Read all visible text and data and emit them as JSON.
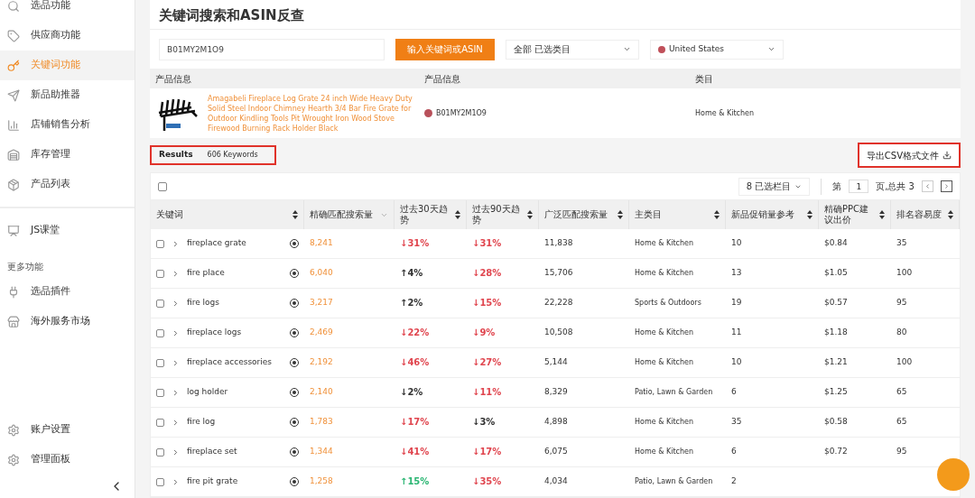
{
  "sidebar": {
    "items": [
      {
        "label": "选品功能",
        "selected": false
      },
      {
        "label": "供应商功能",
        "selected": false
      },
      {
        "label": "关键词功能",
        "selected": true
      },
      {
        "label": "新品助推器",
        "selected": false
      },
      {
        "label": "店铺销售分析",
        "selected": false
      },
      {
        "label": "库存管理",
        "selected": false
      },
      {
        "label": "产品列表",
        "selected": false
      },
      {
        "label": "JS课堂",
        "selected": false
      }
    ],
    "more_heading": "更多功能",
    "more_items": [
      {
        "label": "选品插件",
        "selected": false
      },
      {
        "label": "海外服务市场",
        "selected": false
      }
    ],
    "bottom_items": [
      {
        "label": "账户设置",
        "selected": false
      },
      {
        "label": "管理面板",
        "selected": false
      }
    ]
  },
  "page_title": "关键词搜索和ASIN反查",
  "search": {
    "value": "B01MY2M1O9",
    "button": "输入关键词或ASIN",
    "category": "全部 已选类目",
    "country": "United States"
  },
  "product_table": {
    "columns": [
      "产品信息",
      "产品信息",
      "类目"
    ],
    "row": {
      "title": "Amagabeli Fireplace Log Grate 24 inch Wide Heavy Duty Solid Steel Indoor Chimney Hearth 3/4 Bar Fire Grate for Outdoor Kindling Tools Pit Wrought Iron Wood Stove Firewood Burning Rack Holder Black",
      "asin": "B01MY2M1O9",
      "category": "Home & Kitchen"
    }
  },
  "results": {
    "label": "Results",
    "count": "606 Keywords",
    "highlighted": true
  },
  "export_button": {
    "label": "导出CSV格式文件",
    "highlighted": true
  },
  "toolbar": {
    "select_all_checked": false,
    "columns_select": "8 已选栏目",
    "page_prefix": "第",
    "page": "1",
    "page_suffix": "页,总共 3"
  },
  "keyword_table": {
    "columns": [
      "关键词",
      "精确匹配搜索量",
      "过去30天趋势",
      "过去90天趋势",
      "广泛匹配搜索量",
      "主类目",
      "新品促销量参考",
      "精确PPC建议出价",
      "排名容易度"
    ],
    "rows": [
      {
        "checked": false,
        "keyword": "fireplace grate",
        "exact": "8,241",
        "t30": {
          "color": "#e0464f",
          "text": "↓31%"
        },
        "t90": {
          "color": "#e0464f",
          "text": "↓31%"
        },
        "broad": "11,838",
        "category": "Home & Kitchen",
        "promo": "10",
        "ppc": "$0.84",
        "ease": "35"
      },
      {
        "checked": false,
        "keyword": "fire place",
        "exact": "6,040",
        "t30": {
          "color": "#333333",
          "text": "↑4%"
        },
        "t90": {
          "color": "#e0464f",
          "text": "↓28%"
        },
        "broad": "15,706",
        "category": "Home & Kitchen",
        "promo": "13",
        "ppc": "$1.05",
        "ease": "100"
      },
      {
        "checked": false,
        "keyword": "fire logs",
        "exact": "3,217",
        "t30": {
          "color": "#333333",
          "text": "↑2%"
        },
        "t90": {
          "color": "#e0464f",
          "text": "↓15%"
        },
        "broad": "22,228",
        "category": "Sports & Outdoors",
        "promo": "19",
        "ppc": "$0.57",
        "ease": "95"
      },
      {
        "checked": false,
        "keyword": "fireplace logs",
        "exact": "2,469",
        "t30": {
          "color": "#e0464f",
          "text": "↓22%"
        },
        "t90": {
          "color": "#e0464f",
          "text": "↓9%"
        },
        "broad": "10,508",
        "category": "Home & Kitchen",
        "promo": "11",
        "ppc": "$1.18",
        "ease": "80"
      },
      {
        "checked": false,
        "keyword": "fireplace accessories",
        "exact": "2,192",
        "t30": {
          "color": "#e0464f",
          "text": "↓46%"
        },
        "t90": {
          "color": "#e0464f",
          "text": "↓27%"
        },
        "broad": "5,144",
        "category": "Home & Kitchen",
        "promo": "10",
        "ppc": "$1.21",
        "ease": "100"
      },
      {
        "checked": false,
        "keyword": "log holder",
        "exact": "2,140",
        "t30": {
          "color": "#333333",
          "text": "↓2%"
        },
        "t90": {
          "color": "#e0464f",
          "text": "↓11%"
        },
        "broad": "8,329",
        "category": "Patio, Lawn & Garden",
        "promo": "6",
        "ppc": "$1.25",
        "ease": "65"
      },
      {
        "checked": false,
        "keyword": "fire log",
        "exact": "1,783",
        "t30": {
          "color": "#e0464f",
          "text": "↓17%"
        },
        "t90": {
          "color": "#333333",
          "text": "↓3%"
        },
        "broad": "4,898",
        "category": "Home & Kitchen",
        "promo": "35",
        "ppc": "$0.58",
        "ease": "65"
      },
      {
        "checked": false,
        "keyword": "fireplace set",
        "exact": "1,344",
        "t30": {
          "color": "#e0464f",
          "text": "↓41%"
        },
        "t90": {
          "color": "#e0464f",
          "text": "↓17%"
        },
        "broad": "6,075",
        "category": "Home & Kitchen",
        "promo": "6",
        "ppc": "$0.72",
        "ease": "95"
      },
      {
        "checked": false,
        "keyword": "fire pit grate",
        "exact": "1,258",
        "t30": {
          "color": "#2bb673",
          "text": "↑15%"
        },
        "t90": {
          "color": "#e0464f",
          "text": "↓35%"
        },
        "broad": "4,034",
        "category": "Patio, Lawn & Garden",
        "promo": "2"
      }
    ]
  }
}
